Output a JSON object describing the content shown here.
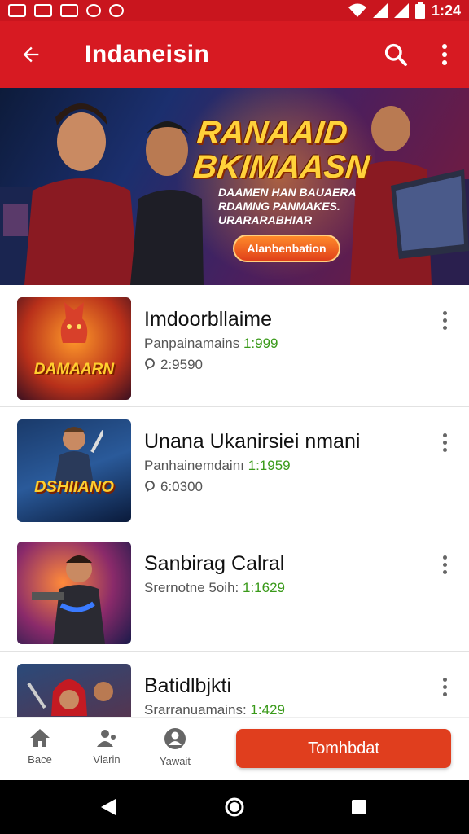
{
  "status_bar": {
    "icons": [
      "notification-icon-1",
      "chart-notification-icon",
      "equalizer-notification-icon",
      "messenger-icon",
      "spotify-icon"
    ],
    "time": "1:24"
  },
  "app_bar": {
    "title": "Indaneisin",
    "icons": [
      "back-arrow-icon",
      "search-icon",
      "more-vert-icon"
    ]
  },
  "banner": {
    "title": "RANAAID BKIMAASN",
    "subtitle": "DAAMEN HAN BAUAERA RDAMNG PANMAKES. URARARABHIAR",
    "cta": "Alanbenbation",
    "accent": "#ffd23a"
  },
  "list": {
    "items": [
      {
        "title": "Imdoorbllaime",
        "meta_label": "Panpainamains",
        "price": "1:999",
        "count": "2:9590",
        "thumb_text": "DAMAARN"
      },
      {
        "title": "Unana Ukanirsiei nmani",
        "meta_label": "Panhainemdainı",
        "price": "1:1959",
        "count": "6:0300",
        "thumb_text": "DSHIIANO"
      },
      {
        "title": "Sanbirag Calral",
        "meta_label": "Srernotne 5oih:",
        "price": "1:1629",
        "count": "",
        "thumb_text": ""
      },
      {
        "title": "Batidlbjkti",
        "meta_label": "Srarranuamains:",
        "price": "1:429",
        "count": "",
        "thumb_text": ""
      }
    ]
  },
  "bottom_nav": {
    "items": [
      {
        "label": "Bace",
        "icon": "home-icon"
      },
      {
        "label": "Vlarin",
        "icon": "person-group-icon"
      },
      {
        "label": "Yawait",
        "icon": "account-icon"
      }
    ],
    "primary_button": "Tomhbdat",
    "primary_color": "#e03e1e"
  },
  "system_nav": {
    "icons": [
      "back-triangle-icon",
      "home-circle-icon",
      "recents-square-icon"
    ]
  },
  "colors": {
    "app_bar": "#d71a22",
    "status_bar": "#c9151e",
    "price_green": "#3a9a1a"
  }
}
